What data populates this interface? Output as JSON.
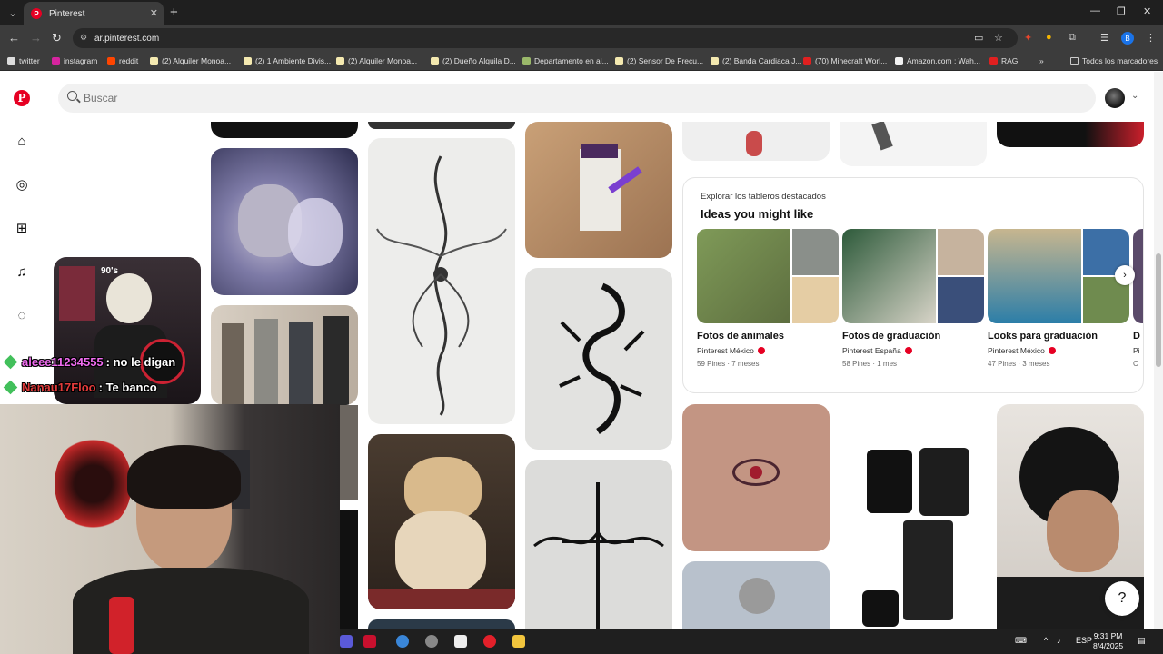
{
  "browser": {
    "tab_title": "Pinterest",
    "url": "ar.pinterest.com",
    "bookmarks": [
      "twitter",
      "instagram",
      "reddit",
      "(2) Alquiler Monoa...",
      "(2) 1 Ambiente Divis...",
      "(2) Alquiler Monoa...",
      "(2) Dueño Alquila D...",
      "Departamento en al...",
      "(2) Sensor De Frecu...",
      "(2) Banda Cardiaca J...",
      "(70) Minecraft Worl...",
      "Amazon.com : Wah...",
      "RAG"
    ],
    "all_bookmarks": "Todos los marcadores"
  },
  "search": {
    "placeholder": "Buscar"
  },
  "boards": {
    "subtitle": "Explorar los tableros destacados",
    "title": "Ideas you might like",
    "items": [
      {
        "name": "Fotos de animales",
        "owner": "Pinterest México",
        "meta": "59 Pines · 7 meses"
      },
      {
        "name": "Fotos de graduación",
        "owner": "Pinterest España",
        "meta": "58 Pines · 1 mes"
      },
      {
        "name": "Looks para graduación",
        "owner": "Pinterest México",
        "meta": "47 Pines · 3 meses"
      },
      {
        "name": "D",
        "owner": "Pi",
        "meta": "C"
      }
    ]
  },
  "stream": {
    "chat": [
      {
        "user": "aleee11234555",
        "message": ": no le digan",
        "color": "#f06cf0"
      },
      {
        "user": "Nanau17Floo",
        "message": ": Te banco",
        "color": "#e23b3b"
      }
    ]
  },
  "pin_texts": {
    "skeleton_sign": "90's"
  },
  "taskbar": {
    "lang": "ESP",
    "time": "9:31 PM",
    "date": "8/4/2025"
  },
  "colors": {
    "pinterest_red": "#e60023",
    "chrome_dark": "#3c3c3c"
  }
}
